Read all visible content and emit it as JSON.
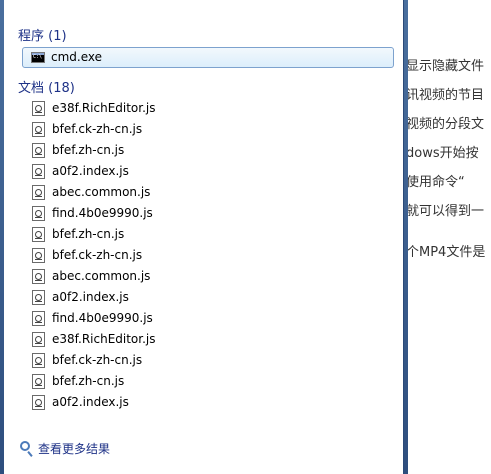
{
  "background_doc": {
    "lines": [
      "显示隐藏文件",
      "讯视频的节目",
      "视频的分段文",
      "dows开始按",
      "使用命令“",
      "就可以得到一",
      "个MP4文件是"
    ]
  },
  "start_menu": {
    "programs_header": "程序 (1)",
    "programs": [
      {
        "label": "cmd.exe",
        "icon": "cmd-icon"
      }
    ],
    "documents_header": "文档 (18)",
    "documents": [
      "e38f.RichEditor.js",
      "bfef.ck-zh-cn.js",
      "bfef.zh-cn.js",
      "a0f2.index.js",
      "abec.common.js",
      "find.4b0e9990.js",
      "bfef.zh-cn.js",
      "bfef.ck-zh-cn.js",
      "abec.common.js",
      "a0f2.index.js",
      "find.4b0e9990.js",
      "e38f.RichEditor.js",
      "bfef.ck-zh-cn.js",
      "bfef.zh-cn.js",
      "a0f2.index.js"
    ],
    "see_more": "查看更多结果",
    "see_more_icon": "search-icon"
  },
  "colors": {
    "header_text": "#1e3287",
    "selection_bg": "#dceefb",
    "selection_border": "#7da2ce",
    "frame": "#2e4e7e"
  }
}
